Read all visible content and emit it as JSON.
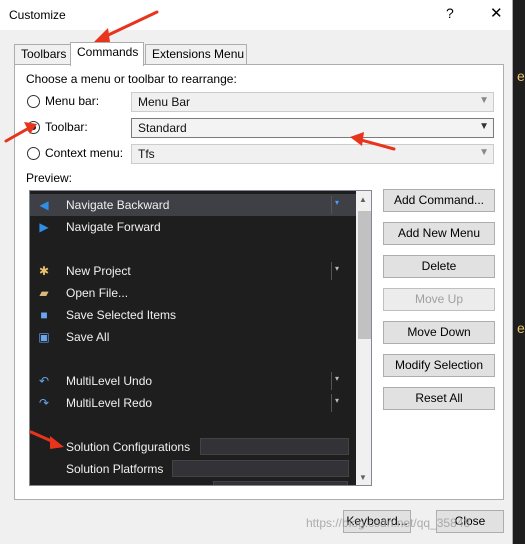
{
  "window": {
    "title": "Customize",
    "help_label": "?",
    "close_label": "✕"
  },
  "tabs": [
    {
      "label": "Toolbars"
    },
    {
      "label": "Commands",
      "active": true
    },
    {
      "label": "Extensions Menu"
    }
  ],
  "choose_label": "Choose a menu or toolbar to rearrange:",
  "options": {
    "menu_bar": {
      "label": "Menu bar:",
      "value": "Menu Bar",
      "checked": false
    },
    "toolbar": {
      "label": "Toolbar:",
      "value": "Standard",
      "checked": true
    },
    "context_menu": {
      "label": "Context menu:",
      "value": "Tfs",
      "checked": false
    }
  },
  "preview_label": "Preview:",
  "preview_items": {
    "navigate_backward": "Navigate Backward",
    "navigate_forward": "Navigate Forward",
    "new_project": "New Project",
    "open_file": "Open File...",
    "save_selected": "Save Selected Items",
    "save_all": "Save All",
    "undo": "MultiLevel Undo",
    "redo": "MultiLevel Redo",
    "solution_configurations": "Solution Configurations",
    "solution_platforms": "Solution Platforms"
  },
  "buttons": {
    "add_command": "Add Command...",
    "add_new_menu": "Add New Menu",
    "delete": "Delete",
    "move_up": "Move Up",
    "move_down": "Move Down",
    "modify_selection": "Modify Selection",
    "reset_all": "Reset All"
  },
  "footer": {
    "keyboard": "Keyboard...",
    "close": "Close"
  },
  "watermark": "https://blog.csdn.net/qq_35843",
  "colors": {
    "annotation": "#e8341c",
    "preview_bg": "#1e1e1e",
    "selected_row": "#3f3f46"
  }
}
